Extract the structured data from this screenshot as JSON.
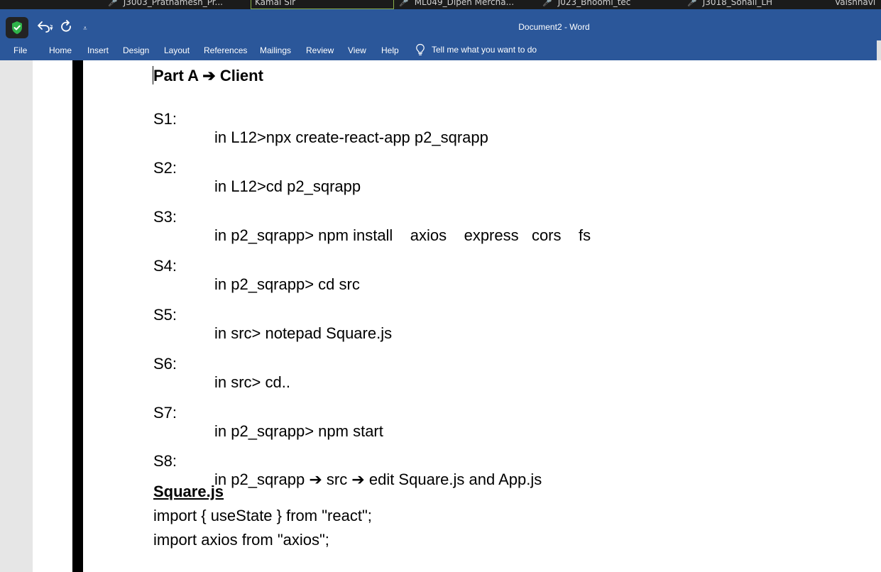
{
  "meeting_tiles": [
    "J3003_Prathamesh_Pr...",
    "Kamal Sir",
    "ML049_Dipen Mercha...",
    "J023_Bhoomi_tec",
    "J3018_Sonali_LH",
    "Vaishnavi"
  ],
  "window": {
    "title": "Document2 - Word"
  },
  "quick_access": {
    "undo_icon": "undo-icon",
    "redo_icon": "redo-icon",
    "customize_icon": "customize-icon"
  },
  "ribbon": {
    "tabs": [
      "File",
      "Home",
      "Insert",
      "Design",
      "Layout",
      "References",
      "Mailings",
      "Review",
      "View",
      "Help"
    ],
    "tell_me": "Tell me what you want to do"
  },
  "document": {
    "heading": "Part A ➔ Client",
    "steps": [
      {
        "label": "S1:",
        "text": "in L12>npx create-react-app p2_sqrapp"
      },
      {
        "label": "S2:",
        "text": "in L12>cd p2_sqrapp"
      },
      {
        "label": "S3:",
        "text": "in p2_sqrapp> npm install    axios    express   cors    fs"
      },
      {
        "label": "S4:",
        "text": "in p2_sqrapp> cd src"
      },
      {
        "label": "S5:",
        "text": "in src> notepad Square.js"
      },
      {
        "label": "S6:",
        "text": "in src> cd.."
      },
      {
        "label": "S7:",
        "text": "in p2_sqrapp> npm start"
      },
      {
        "label": "S8:",
        "text": "in p2_sqrapp ➔ src ➔ edit Square.js and App.js"
      }
    ],
    "subheading": "Square.js",
    "code_lines": [
      "import { useState } from \"react\";",
      "import axios from \"axios\";"
    ]
  }
}
